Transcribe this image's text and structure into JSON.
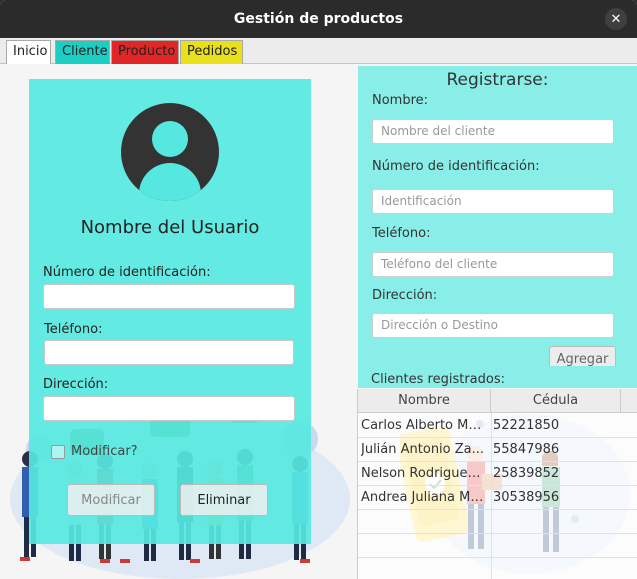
{
  "window": {
    "title": "Gestión de productos",
    "close_glyph": "✕"
  },
  "tabs": [
    {
      "label": "Inicio",
      "color": "#ffffff"
    },
    {
      "label": "Cliente",
      "color": "#1ccfc4"
    },
    {
      "label": "Producto",
      "color": "#e02626"
    },
    {
      "label": "Pedidos",
      "color": "#e8e01c"
    }
  ],
  "profile": {
    "username": "Nombre del Usuario",
    "id_label": "Número de identificación:",
    "id_value": "",
    "phone_label": "Teléfono:",
    "phone_value": "",
    "address_label": "Dirección:",
    "address_value": "",
    "modify_checkbox_label": "Modificar?",
    "modify_button": "Modificar",
    "delete_button": "Eliminar",
    "avatar_icon": "user-avatar-icon"
  },
  "register": {
    "title": "Registrarse:",
    "name_label": "Nombre:",
    "name_placeholder": "Nombre del cliente",
    "id_label": "Número de identificación:",
    "id_placeholder": "Identificación",
    "phone_label": "Teléfono:",
    "phone_placeholder": "Teléfono del cliente",
    "address_label": "Dirección:",
    "address_placeholder": "Dirección o Destino",
    "add_button": "Agregar"
  },
  "clients": {
    "label": "Clientes registrados:",
    "columns": [
      "Nombre",
      "Cédula"
    ],
    "rows": [
      [
        "Carlos Alberto Ma...",
        "52221850"
      ],
      [
        "Julián Antonio Za...",
        "55847986"
      ],
      [
        "Nelson Rodriguez ...",
        "25839852"
      ],
      [
        "Andrea Juliana Mo...",
        "30538956"
      ]
    ]
  },
  "colors": {
    "card_cyan": "#56e8e0",
    "panel_cyan": "#89ede8",
    "titlebar": "#2b2b2b"
  }
}
